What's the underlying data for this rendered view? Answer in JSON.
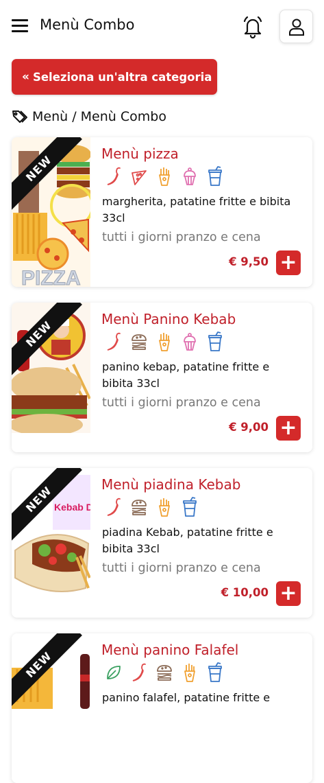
{
  "header": {
    "title": "Menù Combo"
  },
  "category_button": {
    "label": "Seleziona un'altra categoria",
    "chevron": "«"
  },
  "breadcrumb": {
    "text": "Menù / Menù Combo"
  },
  "add_symbol": "+",
  "items": [
    {
      "title": "Menù pizza",
      "badge": "NEW",
      "icons": [
        "chili-icon",
        "pizza-icon",
        "fries-icon",
        "cupcake-icon",
        "drink-icon"
      ],
      "description": "margherita, patatine fritte e bibita 33cl",
      "availability": "tutti i giorni pranzo e cena",
      "price": "€ 9,50",
      "image_caption": "PIZZA"
    },
    {
      "title": "Menù Panino Kebab",
      "badge": "NEW",
      "icons": [
        "chili-icon",
        "burger-icon",
        "fries-icon",
        "cupcake-icon",
        "drink-icon"
      ],
      "description": "panino kebap, patatine fritte e bibita 33cl",
      "availability": "tutti i giorni pranzo e cena",
      "price": "€ 9,00"
    },
    {
      "title": "Menù piadina Kebab",
      "badge": "NEW",
      "icons": [
        "chili-icon",
        "burger-icon",
        "fries-icon",
        "drink-icon"
      ],
      "description": "piadina Kebab, patatine fritte e bibita 33cl",
      "availability": "tutti i giorni pranzo e cena",
      "price": "€ 10,00",
      "image_caption": "Kebab Döne"
    },
    {
      "title": "Menù panino Falafel",
      "badge": "NEW",
      "icons": [
        "leaf-icon",
        "chili-icon",
        "burger-icon",
        "fries-icon",
        "drink-icon"
      ],
      "description": "panino falafel, patatine fritte e",
      "availability": "",
      "price": ""
    }
  ],
  "colors": {
    "accent": "#d42a2a",
    "title_red": "#c0202a",
    "icon_red": "#e04a4a",
    "icon_orange": "#f0a030",
    "icon_pink": "#e070b0",
    "icon_blue": "#3a78c8",
    "icon_green": "#3aa060"
  }
}
